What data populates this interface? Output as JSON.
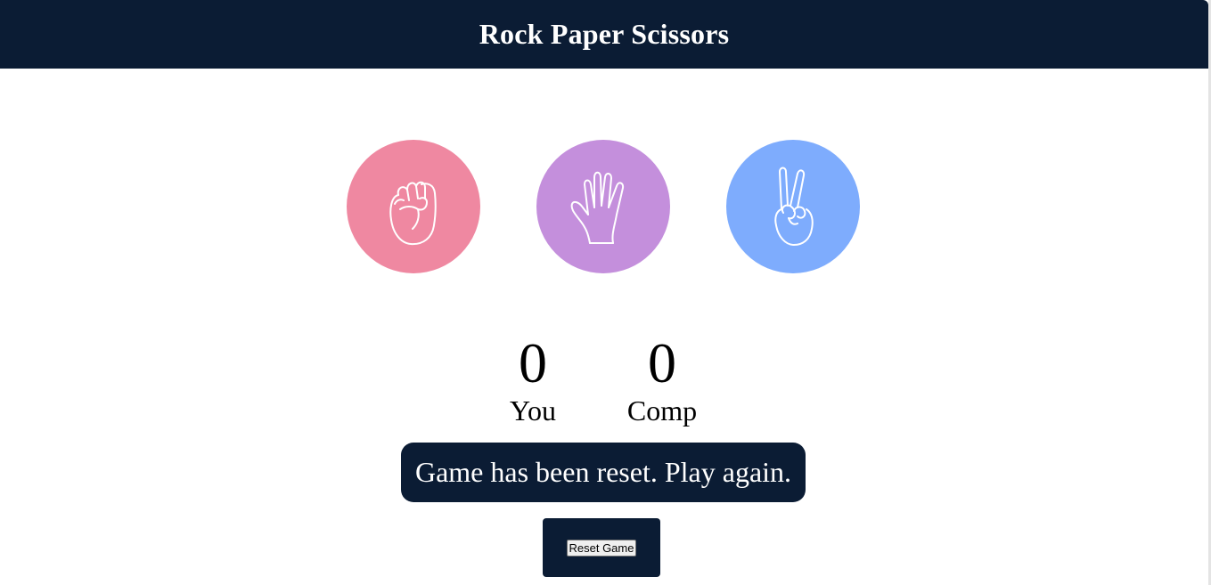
{
  "header": {
    "title": "Rock Paper Scissors"
  },
  "choices": [
    {
      "id": "rock",
      "color": "#ef88a1",
      "icon": "rock-fist-icon"
    },
    {
      "id": "paper",
      "color": "#c48fdc",
      "icon": "paper-hand-icon"
    },
    {
      "id": "scissors",
      "color": "#7eacfd",
      "icon": "scissors-peace-hand-icon"
    }
  ],
  "scoreboard": {
    "you": {
      "score": "0",
      "label": "You"
    },
    "comp": {
      "score": "0",
      "label": "Comp"
    }
  },
  "message": "Game has been reset. Play again.",
  "reset_button": {
    "label": "Reset Game"
  },
  "colors": {
    "navy": "#0b1c34"
  }
}
